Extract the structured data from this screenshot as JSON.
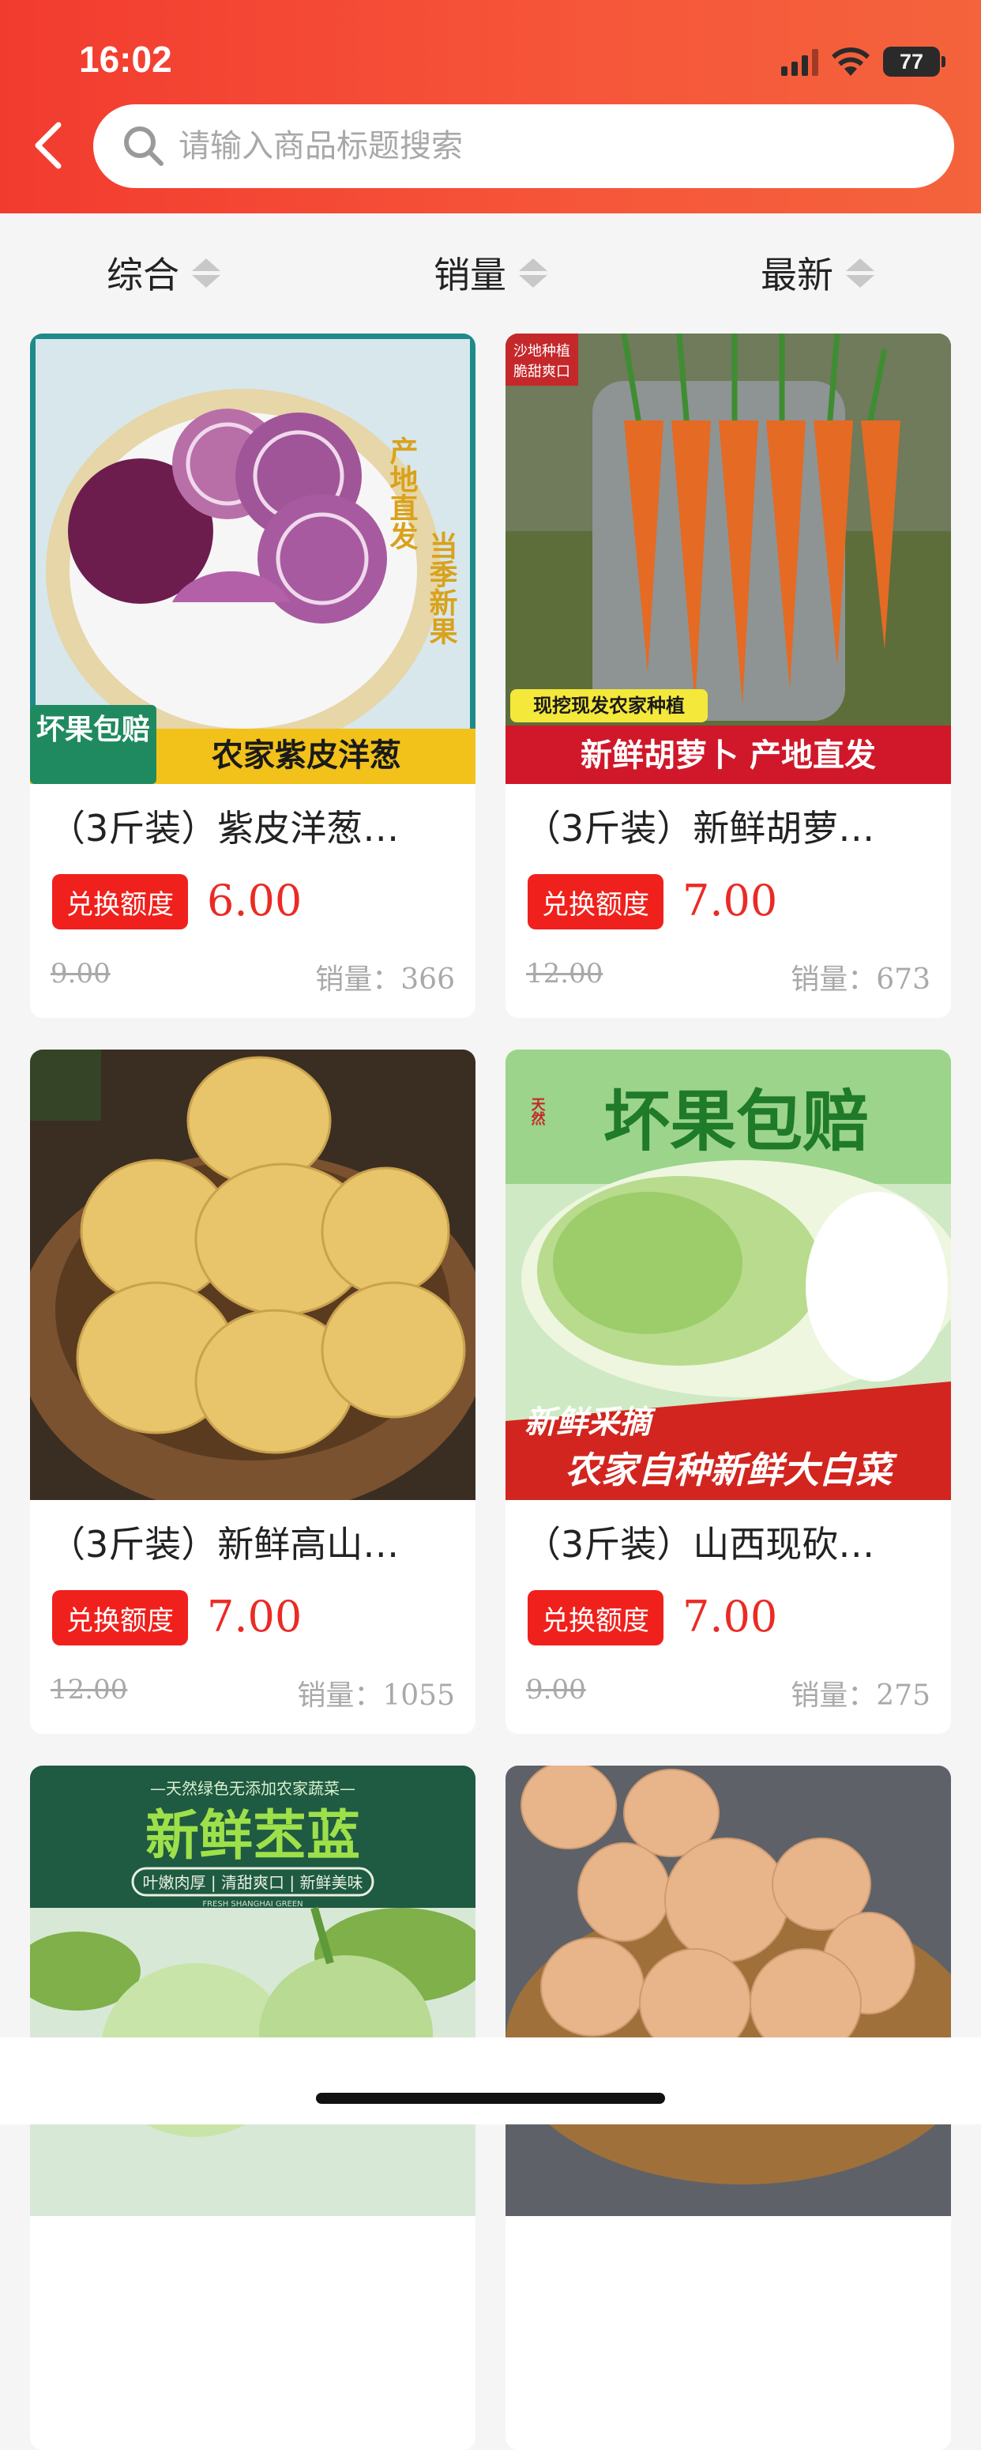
{
  "status": {
    "time": "16:02",
    "battery": "77"
  },
  "search": {
    "placeholder": "请输入商品标题搜索"
  },
  "sort": [
    {
      "label": "综合"
    },
    {
      "label": "销量"
    },
    {
      "label": "最新"
    }
  ],
  "badge_label": "兑换额度",
  "sales_label": "销量：",
  "products": [
    {
      "title": "（3斤装）紫皮洋葱…",
      "price": "6.00",
      "original_price": "9.00",
      "sales": "366",
      "image_text": {
        "banner": "农家紫皮洋葱",
        "corner": "坏果包赔",
        "side1": "产地直发",
        "side2": "当季新果"
      }
    },
    {
      "title": "（3斤装）新鲜胡萝…",
      "price": "7.00",
      "original_price": "12.00",
      "sales": "673",
      "image_text": {
        "banner": "新鲜胡萝卜 产地直发",
        "tag": "现挖现发农家种植",
        "corner1": "沙地种植",
        "corner2": "脆甜爽口"
      }
    },
    {
      "title": "（3斤装）新鲜高山…",
      "price": "7.00",
      "original_price": "12.00",
      "sales": "1055",
      "image_text": {}
    },
    {
      "title": "（3斤装）山西现砍…",
      "price": "7.00",
      "original_price": "9.00",
      "sales": "275",
      "image_text": {
        "headline": "坏果包赔",
        "tag": "新鲜采摘",
        "banner": "农家自种新鲜大白菜",
        "seal": "天然"
      }
    },
    {
      "title": "",
      "image_text": {
        "top": "—天然绿色无添加农家蔬菜—",
        "headline": "新鲜苤蓝",
        "sub": "叶嫩肉厚 | 清甜爽口 | 新鲜美味",
        "en": "FRESH SHANGHAI GREEN"
      }
    },
    {
      "title": "",
      "image_text": {}
    }
  ],
  "colors": {
    "accent": "#f0201c",
    "header_start": "#f23b2f",
    "header_end": "#f4633c",
    "price": "#ea2b25"
  }
}
